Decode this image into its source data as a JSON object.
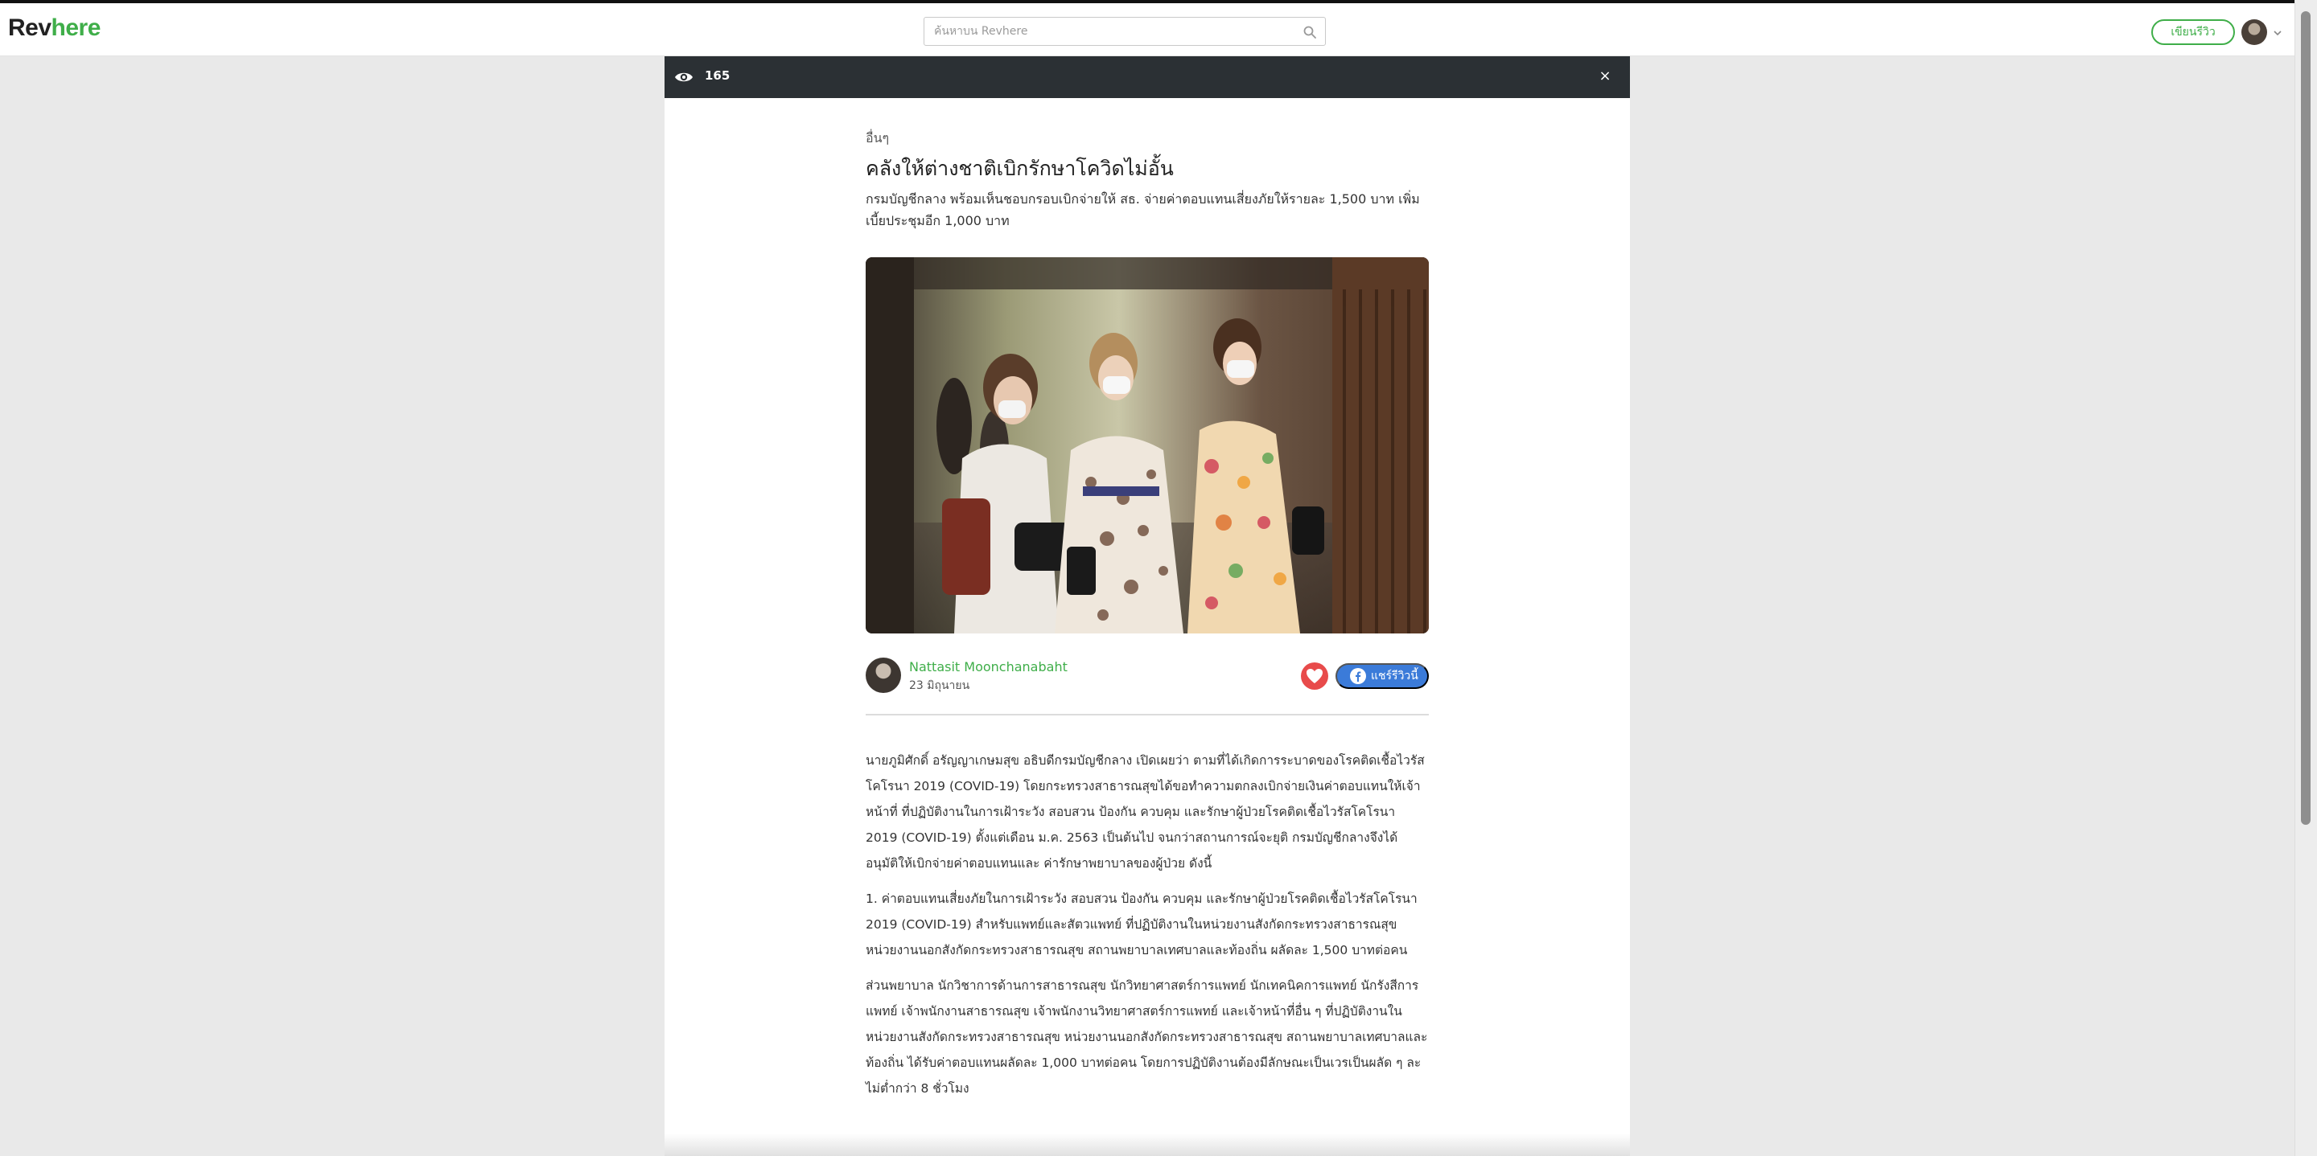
{
  "header": {
    "logo_part1": "Rev",
    "logo_part2": "here",
    "search_placeholder": "ค้นหาบน Revhere",
    "write_review_label": "เขียนรีวิว"
  },
  "modal": {
    "view_count": "165",
    "close_label": "×"
  },
  "article": {
    "category": "อื่นๆ",
    "title": "คลังให้ต่างชาติเบิกรักษาโควิดไม่อั้น",
    "subtitle": "กรมบัญชีกลาง พร้อมเห็นชอบกรอบเบิกจ่ายให้ สธ. จ่ายค่าตอบแทนเสี่ยงภัยให้รายละ 1,500 บาท เพิ่มเบี้ยประชุมอีก 1,000 บาท",
    "author_name": "Nattasit Moonchanabaht",
    "date": "23 มิถุนายน",
    "share_label": "แชร์รีวิวนี้",
    "paragraphs": [
      "นายภูมิศักดิ์ อรัญญาเกษมสุข อธิบดีกรมบัญชีกลาง เปิดเผยว่า ตามที่ได้เกิดการระบาดของโรคติดเชื้อไวรัส  โคโรนา 2019 (COVID-19) โดยกระทรวงสาธารณสุขได้ขอทำความตกลงเบิกจ่ายเงินค่าตอบแทนให้เจ้าหน้าที่ ที่ปฏิบัติงานในการเฝ้าระวัง สอบสวน ป้องกัน ควบคุม และรักษาผู้ป่วยโรคติดเชื้อไวรัสโคโรนา 2019 (COVID-19) ตั้งแต่เดือน ม.ค. 2563 เป็นต้นไป จนกว่าสถานการณ์จะยุติ กรมบัญชีกลางจึงได้อนุมัติให้เบิกจ่ายค่าตอบแทนและ ค่ารักษาพยาบาลของผู้ป่วย ดังนี้",
      "1. ค่าตอบแทนเสี่ยงภัยในการเฝ้าระวัง สอบสวน ป้องกัน ควบคุม และรักษาผู้ป่วยโรคติดเชื้อไวรัสโคโรนา 2019 (COVID-19) สำหรับแพทย์และสัตวแพทย์ ที่ปฏิบัติงานในหน่วยงานสังกัดกระทรวงสาธารณสุข  หน่วยงานนอกสังกัดกระทรวงสาธารณสุข สถานพยาบาลเทศบาลและท้องถิ่น ผลัดละ 1,500 บาทต่อคน",
      "ส่วนพยาบาล นักวิชาการด้านการสาธารณสุข นักวิทยาศาสตร์การแพทย์ นักเทคนิคการแพทย์ นักรังสีการแพทย์ เจ้าพนักงานสาธารณสุข เจ้าพนักงานวิทยาศาสตร์การแพทย์ และเจ้าหน้าที่อื่น ๆ ที่ปฏิบัติงานในหน่วยงานสังกัดกระทรวงสาธารณสุข หน่วยงานนอกสังกัดกระทรวงสาธารณสุข สถานพยาบาลเทศบาลและท้องถิ่น ได้รับค่าตอบแทนผลัดละ 1,000 บาทต่อคน โดยการปฏิบัติงานต้องมีลักษณะเป็นเวรเป็นผลัด ๆ ละ ไม่ต่ำกว่า 8 ชั่วโมง"
    ]
  },
  "colors": {
    "brand_green": "#3fae49",
    "modal_bar": "#2b3034",
    "heart_red": "#e84b4b",
    "facebook_blue": "#3b7bd9"
  },
  "icons": [
    "search-icon",
    "eye-icon",
    "close-icon",
    "heart-icon",
    "facebook-icon",
    "chevron-down-icon"
  ]
}
